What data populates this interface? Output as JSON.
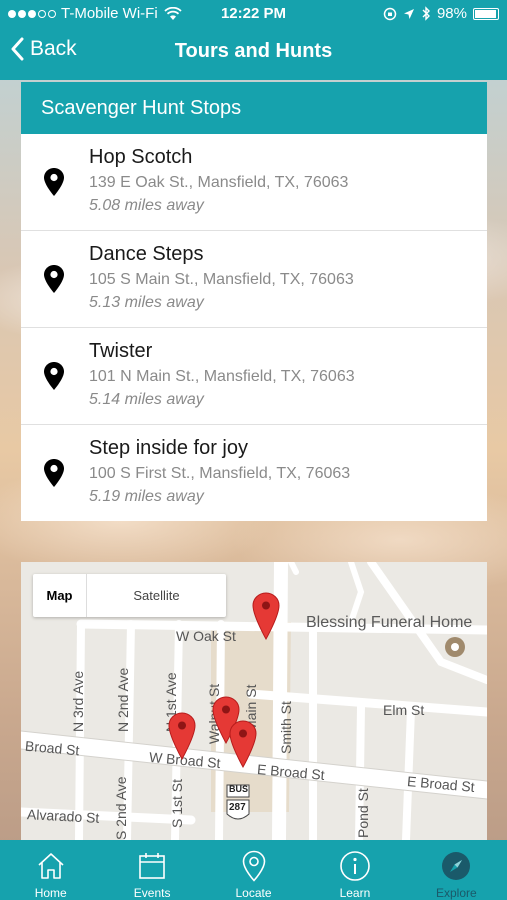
{
  "status_bar": {
    "carrier": "T-Mobile Wi-Fi",
    "time": "12:22 PM",
    "battery": "98%"
  },
  "nav": {
    "back_label": "Back",
    "title": "Tours and Hunts"
  },
  "card": {
    "header": "Scavenger Hunt Stops",
    "stops": [
      {
        "name": "Hop Scotch",
        "address": "139 E Oak St., Mansfield, TX, 76063",
        "distance": "5.08 miles away"
      },
      {
        "name": "Dance Steps",
        "address": "105 S Main St., Mansfield, TX, 76063",
        "distance": "5.13 miles away"
      },
      {
        "name": "Twister",
        "address": "101 N Main St., Mansfield, TX, 76063",
        "distance": "5.14 miles away"
      },
      {
        "name": "Step inside for joy",
        "address": "100 S First St., Mansfield, TX, 76063",
        "distance": "5.19 miles away"
      }
    ]
  },
  "map": {
    "toggle": {
      "map_label": "Map",
      "satellite_label": "Satellite",
      "selected": "Map"
    },
    "poi": "Blessing Funeral Home",
    "streets": {
      "w_oak": "W Oak St",
      "elm": "Elm St",
      "broad": "Broad St",
      "w_broad": "W Broad St",
      "e_broad_1": "E Broad St",
      "e_broad_2": "E Broad St",
      "alvarado": "Alvarado St",
      "n_3rd": "N 3rd Ave",
      "n_2nd": "N 2nd Ave",
      "n_1st": "N 1st Ave",
      "s_2nd": "S 2nd Ave",
      "s_1st": "S 1st St",
      "walnut": "Walnut St",
      "main": "Main St",
      "smith": "Smith St",
      "pond": "Pond St",
      "bus": "BUS",
      "route": "287"
    },
    "marker_color": "#e53935"
  },
  "tabs": [
    {
      "label": "Home",
      "icon": "home-icon"
    },
    {
      "label": "Events",
      "icon": "calendar-icon"
    },
    {
      "label": "Locate",
      "icon": "location-pin-icon"
    },
    {
      "label": "Learn",
      "icon": "info-icon"
    },
    {
      "label": "Explore",
      "icon": "compass-icon",
      "active": true
    }
  ],
  "colors": {
    "brand": "#16a2ad",
    "active_tab": "#1a5a6a"
  }
}
